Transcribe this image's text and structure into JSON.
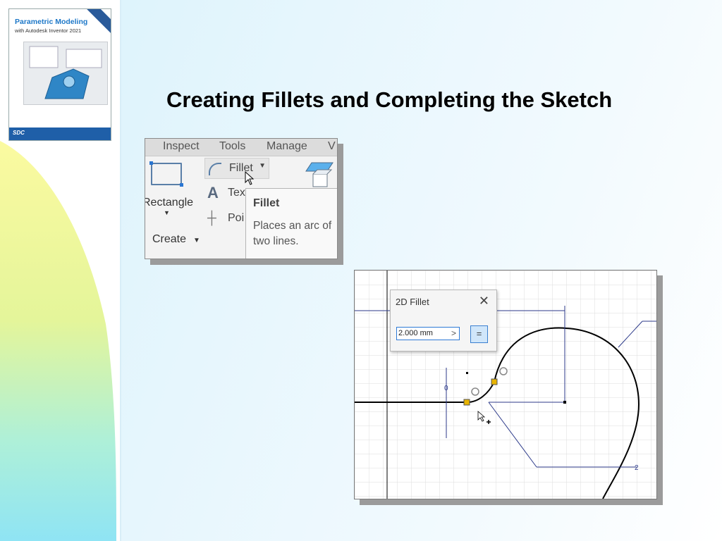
{
  "book_cover": {
    "title": "Parametric Modeling",
    "subtitle": "with Autodesk Inventor 2021",
    "publisher": "SDC"
  },
  "slide": {
    "title": "Creating Fillets and Completing the Sketch"
  },
  "ribbon": {
    "tabs": [
      "Inspect",
      "Tools",
      "Manage",
      "V"
    ],
    "rectangle_label": "Rectangle",
    "fillet_label": "Fillet",
    "text_label": "Tex",
    "point_label": "Poi",
    "create_label": "Create",
    "tooltip": {
      "title": "Fillet",
      "description": "Places an arc of two lines."
    }
  },
  "fillet_dialog": {
    "title": "2D Fillet",
    "close": "✕",
    "radius_value": "2.000 mm",
    "arrow": ">",
    "equal_button": "="
  },
  "sketch_labels": {
    "constraint_v": "0",
    "dim_label": "2"
  },
  "colors": {
    "accent_blue": "#1e78c8",
    "dimension_line": "#2c3a8a",
    "endpoint_yellow": "#e8b400"
  }
}
